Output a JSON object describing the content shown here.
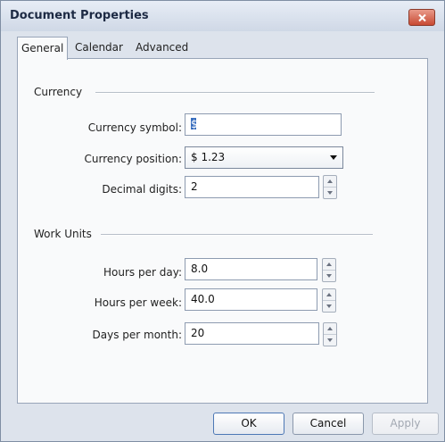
{
  "window": {
    "title": "Document Properties",
    "close_label": "close"
  },
  "tabs": [
    {
      "label": "General",
      "active": true
    },
    {
      "label": "Calendar",
      "active": false
    },
    {
      "label": "Advanced",
      "active": false
    }
  ],
  "currency": {
    "group_label": "Currency",
    "symbol_label": "Currency symbol:",
    "symbol_value": "$",
    "position_label": "Currency position:",
    "position_value": "$ 1.23",
    "decimal_label": "Decimal digits:",
    "decimal_value": "2"
  },
  "work_units": {
    "group_label": "Work Units",
    "hours_day_label": "Hours per day:",
    "hours_day_value": "8.0",
    "hours_week_label": "Hours per week:",
    "hours_week_value": "40.0",
    "days_month_label": "Days per month:",
    "days_month_value": "20"
  },
  "buttons": {
    "ok": "OK",
    "cancel": "Cancel",
    "apply": "Apply"
  },
  "icons": {
    "close": "close-icon",
    "dropdown": "chevron-down-icon",
    "spin_up": "arrow-up-icon",
    "spin_down": "arrow-down-icon"
  },
  "colors": {
    "window_bg": "#dde3ec",
    "close_red": "#c84a33",
    "panel_bg": "#f9fafb"
  }
}
